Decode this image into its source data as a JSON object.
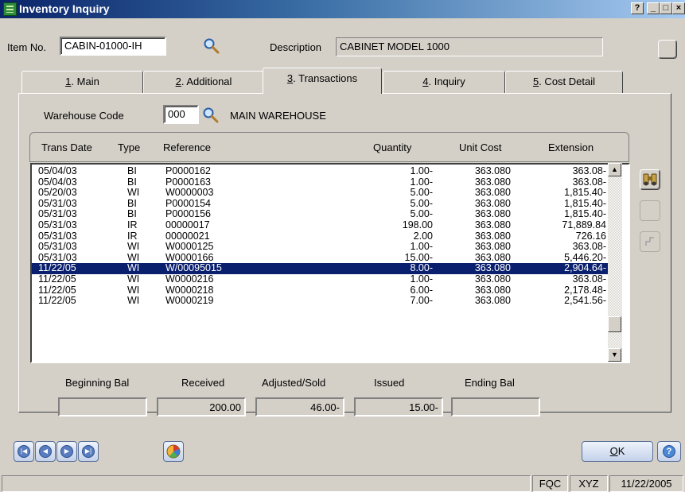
{
  "window": {
    "title": "Inventory Inquiry"
  },
  "header": {
    "item_no_label": "Item No.",
    "item_no_value": "CABIN-01000-IH",
    "description_label": "Description",
    "description_value": "CABINET MODEL 1000"
  },
  "tabs": [
    {
      "num": "1",
      "label": ". Main"
    },
    {
      "num": "2",
      "label": ". Additional"
    },
    {
      "num": "3",
      "label": ". Transactions"
    },
    {
      "num": "4",
      "label": ". Inquiry"
    },
    {
      "num": "5",
      "label": ". Cost Detail"
    }
  ],
  "active_tab_index": 2,
  "warehouse": {
    "label": "Warehouse Code",
    "code": "000",
    "name": "MAIN WAREHOUSE"
  },
  "grid": {
    "columns": [
      "Trans Date",
      "Type",
      "Reference",
      "Quantity",
      "Unit Cost",
      "Extension"
    ],
    "rows": [
      [
        "05/04/03",
        "BI",
        "P0000162",
        "1.00-",
        "363.080",
        "363.08-"
      ],
      [
        "05/04/03",
        "BI",
        "P0000163",
        "1.00-",
        "363.080",
        "363.08-"
      ],
      [
        "05/20/03",
        "WI",
        "W0000003",
        "5.00-",
        "363.080",
        "1,815.40-"
      ],
      [
        "05/31/03",
        "BI",
        "P0000154",
        "5.00-",
        "363.080",
        "1,815.40-"
      ],
      [
        "05/31/03",
        "BI",
        "P0000156",
        "5.00-",
        "363.080",
        "1,815.40-"
      ],
      [
        "05/31/03",
        "IR",
        "00000017",
        "198.00",
        "363.080",
        "71,889.84"
      ],
      [
        "05/31/03",
        "IR",
        "00000021",
        "2.00",
        "363.080",
        "726.16"
      ],
      [
        "05/31/03",
        "WI",
        "W0000125",
        "1.00-",
        "363.080",
        "363.08-"
      ],
      [
        "05/31/03",
        "WI",
        "W0000166",
        "15.00-",
        "363.080",
        "5,446.20-"
      ],
      [
        "11/22/05",
        "WI",
        "W/00095015",
        "8.00-",
        "363.080",
        "2,904.64-"
      ],
      [
        "11/22/05",
        "WI",
        "W0000216",
        "1.00-",
        "363.080",
        "363.08-"
      ],
      [
        "11/22/05",
        "WI",
        "W0000218",
        "6.00-",
        "363.080",
        "2,178.48-"
      ],
      [
        "11/22/05",
        "WI",
        "W0000219",
        "7.00-",
        "363.080",
        "2,541.56-"
      ]
    ],
    "selected_row_index": 9
  },
  "totals": {
    "labels": [
      "Beginning Bal",
      "Received",
      "Adjusted/Sold",
      "Issued",
      "Ending Bal"
    ],
    "values": [
      "",
      "200.00",
      "46.00-",
      "15.00-",
      ""
    ]
  },
  "buttons": {
    "ok": "K",
    "ok_mnemonic": "O"
  },
  "statusbar": {
    "company": "FQC",
    "user": "XYZ",
    "date": "11/22/2005"
  },
  "icons": {
    "lookup": "magnifier-icon",
    "find": "binoculars-icon",
    "nav": [
      "first-record-icon",
      "previous-record-icon",
      "next-record-icon",
      "last-record-icon"
    ],
    "chart": "chart-icon",
    "help": "help-icon"
  }
}
